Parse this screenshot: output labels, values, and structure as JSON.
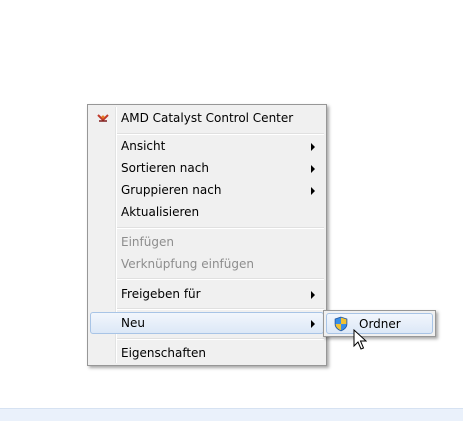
{
  "context_menu": {
    "items": [
      {
        "label": "AMD Catalyst Control Center",
        "icon": "amd-catalyst-icon"
      },
      {
        "label": "Ansicht",
        "submenu": true
      },
      {
        "label": "Sortieren nach",
        "submenu": true
      },
      {
        "label": "Gruppieren nach",
        "submenu": true
      },
      {
        "label": "Aktualisieren"
      },
      {
        "label": "Einfügen",
        "disabled": true
      },
      {
        "label": "Verknüpfung einfügen",
        "disabled": true
      },
      {
        "label": "Freigeben für",
        "submenu": true
      },
      {
        "label": "Neu",
        "submenu": true,
        "highlighted": true
      },
      {
        "label": "Eigenschaften"
      }
    ]
  },
  "submenu": {
    "items": [
      {
        "label": "Ordner",
        "icon": "uac-shield-icon",
        "highlighted": true
      }
    ]
  },
  "colors": {
    "highlight_border": "#a8c4e6",
    "menu_background": "#f0f0f0",
    "disabled_text": "#8d8d8d"
  }
}
